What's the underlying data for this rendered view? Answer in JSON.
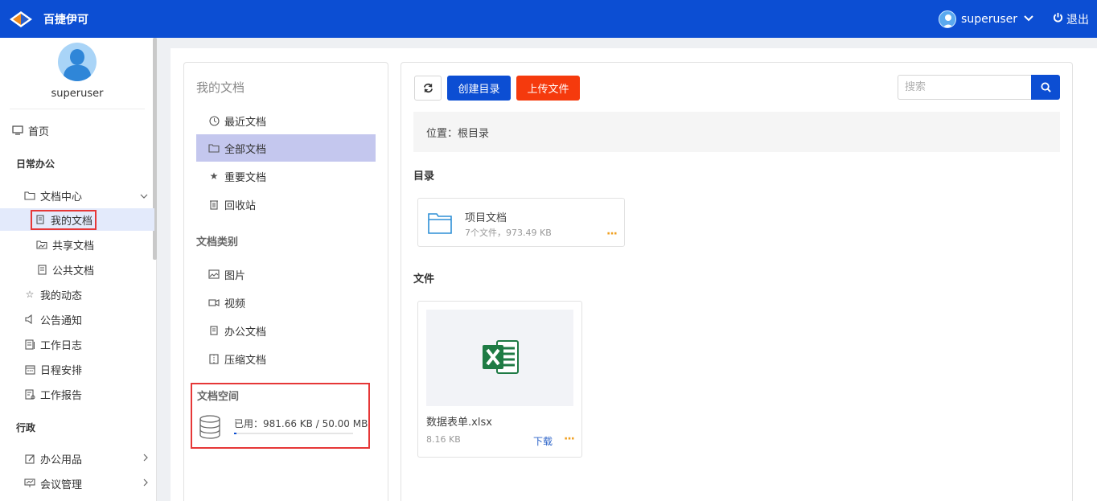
{
  "topbar": {
    "app_title": "百捷伊可",
    "username": "superuser",
    "logout_label": "退出"
  },
  "nav": {
    "username": "superuser",
    "home": "首页",
    "section_office": "日常办公",
    "doc_center": "文档中心",
    "my_docs": "我的文档",
    "shared_docs": "共享文档",
    "public_docs": "公共文档",
    "my_activity": "我的动态",
    "notices": "公告通知",
    "work_log": "工作日志",
    "schedule": "日程安排",
    "work_report": "工作报告",
    "section_admin": "行政",
    "office_supplies": "办公用品",
    "meeting_mgmt": "会议管理"
  },
  "docs_panel": {
    "title": "我的文档",
    "items": [
      {
        "label": "最近文档",
        "icon": "clock-icon"
      },
      {
        "label": "全部文档",
        "icon": "folder-icon"
      },
      {
        "label": "重要文档",
        "icon": "star-icon"
      },
      {
        "label": "回收站",
        "icon": "trash-icon"
      }
    ],
    "category_title": "文档类别",
    "categories": [
      {
        "label": "图片",
        "icon": "image-icon"
      },
      {
        "label": "视频",
        "icon": "video-icon"
      },
      {
        "label": "办公文档",
        "icon": "document-icon"
      },
      {
        "label": "压缩文档",
        "icon": "archive-icon"
      }
    ],
    "space_title": "文档空间",
    "space_used": "已用：981.66 KB / 50.00 MB",
    "space_fraction": 0.019
  },
  "content": {
    "btn_create_dir": "创建目录",
    "btn_upload": "上传文件",
    "search_placeholder": "搜索",
    "location": "位置：根目录",
    "dir_heading": "目录",
    "folder": {
      "name": "项目文档",
      "meta": "7个文件，973.49 KB"
    },
    "file_heading": "文件",
    "file": {
      "name": "数据表单.xlsx",
      "size": "8.16 KB",
      "download": "下载"
    },
    "more_glyph": "···"
  },
  "colors": {
    "primary": "#0c4ed3",
    "upload": "#f53a0d",
    "highlight": "#e63737",
    "active_item": "#c4c7ee"
  }
}
